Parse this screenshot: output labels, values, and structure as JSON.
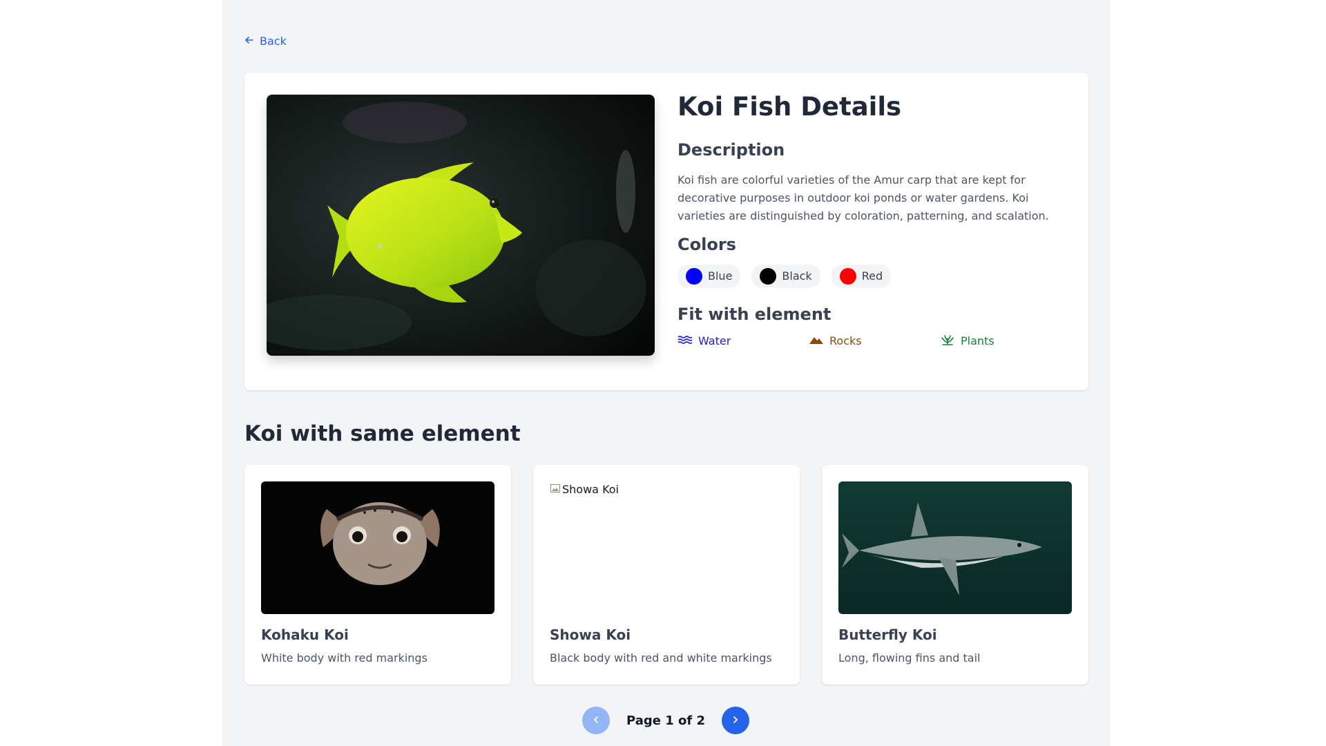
{
  "nav": {
    "back_label": "Back"
  },
  "detail": {
    "title": "Koi Fish Details",
    "description_heading": "Description",
    "description": "Koi fish are colorful varieties of the Amur carp that are kept for decorative purposes in outdoor koi ponds or water gardens. Koi varieties are distinguished by coloration, patterning, and scalation.",
    "colors_heading": "Colors",
    "colors": [
      {
        "label": "Blue",
        "hex": "#0000ff"
      },
      {
        "label": "Black",
        "hex": "#000000"
      },
      {
        "label": "Red",
        "hex": "#ff0000"
      }
    ],
    "elements_heading": "Fit with element",
    "elements": [
      {
        "label": "Water",
        "icon": "water-waves-icon",
        "color": "#1d1dcf"
      },
      {
        "label": "Rocks",
        "icon": "mountain-icon",
        "color": "#8a4b0f"
      },
      {
        "label": "Plants",
        "icon": "plant-icon",
        "color": "#15803d"
      }
    ],
    "image_icon": "yellow-tang-fish-photo"
  },
  "related": {
    "heading": "Koi with same element",
    "items": [
      {
        "name": "Kohaku Koi",
        "description": "White body with red markings",
        "image": "pufferfish-photo"
      },
      {
        "name": "Showa Koi",
        "description": "Black body with red and white markings",
        "image_alt": "Showa Koi"
      },
      {
        "name": "Butterfly Koi",
        "description": "Long, flowing fins and tail",
        "image": "shark-photo"
      }
    ]
  },
  "pagination": {
    "label": "Page 1 of 2",
    "current": 1,
    "total": 2
  },
  "colors": {
    "accent": "#2563eb",
    "accent_disabled": "#93b4f5",
    "page_bg": "#f3f4f6"
  }
}
